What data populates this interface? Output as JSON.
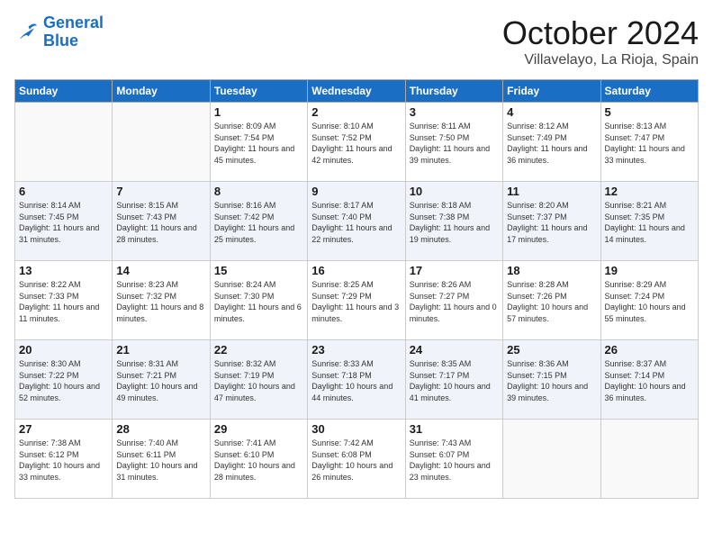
{
  "logo": {
    "line1": "General",
    "line2": "Blue"
  },
  "title": "October 2024",
  "location": "Villavelayo, La Rioja, Spain",
  "days_of_week": [
    "Sunday",
    "Monday",
    "Tuesday",
    "Wednesday",
    "Thursday",
    "Friday",
    "Saturday"
  ],
  "weeks": [
    [
      {
        "num": "",
        "info": ""
      },
      {
        "num": "",
        "info": ""
      },
      {
        "num": "1",
        "info": "Sunrise: 8:09 AM\nSunset: 7:54 PM\nDaylight: 11 hours and 45 minutes."
      },
      {
        "num": "2",
        "info": "Sunrise: 8:10 AM\nSunset: 7:52 PM\nDaylight: 11 hours and 42 minutes."
      },
      {
        "num": "3",
        "info": "Sunrise: 8:11 AM\nSunset: 7:50 PM\nDaylight: 11 hours and 39 minutes."
      },
      {
        "num": "4",
        "info": "Sunrise: 8:12 AM\nSunset: 7:49 PM\nDaylight: 11 hours and 36 minutes."
      },
      {
        "num": "5",
        "info": "Sunrise: 8:13 AM\nSunset: 7:47 PM\nDaylight: 11 hours and 33 minutes."
      }
    ],
    [
      {
        "num": "6",
        "info": "Sunrise: 8:14 AM\nSunset: 7:45 PM\nDaylight: 11 hours and 31 minutes."
      },
      {
        "num": "7",
        "info": "Sunrise: 8:15 AM\nSunset: 7:43 PM\nDaylight: 11 hours and 28 minutes."
      },
      {
        "num": "8",
        "info": "Sunrise: 8:16 AM\nSunset: 7:42 PM\nDaylight: 11 hours and 25 minutes."
      },
      {
        "num": "9",
        "info": "Sunrise: 8:17 AM\nSunset: 7:40 PM\nDaylight: 11 hours and 22 minutes."
      },
      {
        "num": "10",
        "info": "Sunrise: 8:18 AM\nSunset: 7:38 PM\nDaylight: 11 hours and 19 minutes."
      },
      {
        "num": "11",
        "info": "Sunrise: 8:20 AM\nSunset: 7:37 PM\nDaylight: 11 hours and 17 minutes."
      },
      {
        "num": "12",
        "info": "Sunrise: 8:21 AM\nSunset: 7:35 PM\nDaylight: 11 hours and 14 minutes."
      }
    ],
    [
      {
        "num": "13",
        "info": "Sunrise: 8:22 AM\nSunset: 7:33 PM\nDaylight: 11 hours and 11 minutes."
      },
      {
        "num": "14",
        "info": "Sunrise: 8:23 AM\nSunset: 7:32 PM\nDaylight: 11 hours and 8 minutes."
      },
      {
        "num": "15",
        "info": "Sunrise: 8:24 AM\nSunset: 7:30 PM\nDaylight: 11 hours and 6 minutes."
      },
      {
        "num": "16",
        "info": "Sunrise: 8:25 AM\nSunset: 7:29 PM\nDaylight: 11 hours and 3 minutes."
      },
      {
        "num": "17",
        "info": "Sunrise: 8:26 AM\nSunset: 7:27 PM\nDaylight: 11 hours and 0 minutes."
      },
      {
        "num": "18",
        "info": "Sunrise: 8:28 AM\nSunset: 7:26 PM\nDaylight: 10 hours and 57 minutes."
      },
      {
        "num": "19",
        "info": "Sunrise: 8:29 AM\nSunset: 7:24 PM\nDaylight: 10 hours and 55 minutes."
      }
    ],
    [
      {
        "num": "20",
        "info": "Sunrise: 8:30 AM\nSunset: 7:22 PM\nDaylight: 10 hours and 52 minutes."
      },
      {
        "num": "21",
        "info": "Sunrise: 8:31 AM\nSunset: 7:21 PM\nDaylight: 10 hours and 49 minutes."
      },
      {
        "num": "22",
        "info": "Sunrise: 8:32 AM\nSunset: 7:19 PM\nDaylight: 10 hours and 47 minutes."
      },
      {
        "num": "23",
        "info": "Sunrise: 8:33 AM\nSunset: 7:18 PM\nDaylight: 10 hours and 44 minutes."
      },
      {
        "num": "24",
        "info": "Sunrise: 8:35 AM\nSunset: 7:17 PM\nDaylight: 10 hours and 41 minutes."
      },
      {
        "num": "25",
        "info": "Sunrise: 8:36 AM\nSunset: 7:15 PM\nDaylight: 10 hours and 39 minutes."
      },
      {
        "num": "26",
        "info": "Sunrise: 8:37 AM\nSunset: 7:14 PM\nDaylight: 10 hours and 36 minutes."
      }
    ],
    [
      {
        "num": "27",
        "info": "Sunrise: 7:38 AM\nSunset: 6:12 PM\nDaylight: 10 hours and 33 minutes."
      },
      {
        "num": "28",
        "info": "Sunrise: 7:40 AM\nSunset: 6:11 PM\nDaylight: 10 hours and 31 minutes."
      },
      {
        "num": "29",
        "info": "Sunrise: 7:41 AM\nSunset: 6:10 PM\nDaylight: 10 hours and 28 minutes."
      },
      {
        "num": "30",
        "info": "Sunrise: 7:42 AM\nSunset: 6:08 PM\nDaylight: 10 hours and 26 minutes."
      },
      {
        "num": "31",
        "info": "Sunrise: 7:43 AM\nSunset: 6:07 PM\nDaylight: 10 hours and 23 minutes."
      },
      {
        "num": "",
        "info": ""
      },
      {
        "num": "",
        "info": ""
      }
    ]
  ]
}
